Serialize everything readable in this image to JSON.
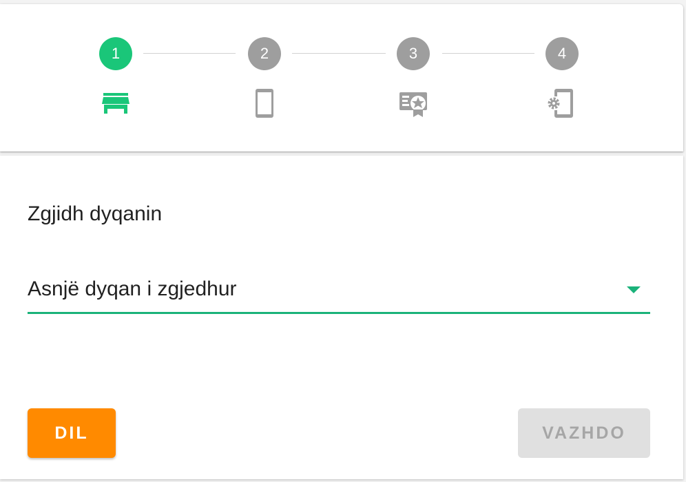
{
  "stepper": {
    "steps": [
      {
        "number": "1",
        "icon": "store-icon",
        "state": "active"
      },
      {
        "number": "2",
        "icon": "smartphone-icon",
        "state": "inactive"
      },
      {
        "number": "3",
        "icon": "loyalty-card-icon",
        "state": "inactive"
      },
      {
        "number": "4",
        "icon": "phone-settings-icon",
        "state": "inactive"
      }
    ]
  },
  "form": {
    "label": "Zgjidh dyqanin",
    "select_value": "Asnjë dyqan i zgjedhur"
  },
  "actions": {
    "exit_label": "DIL",
    "continue_label": "VAZHDO",
    "continue_disabled": true
  },
  "colors": {
    "active_step": "#1ac679",
    "inactive_step": "#9e9e9e",
    "accent": "#1ab27a",
    "exit_button": "#ff8a00",
    "disabled_button": "#e0e0e0"
  }
}
